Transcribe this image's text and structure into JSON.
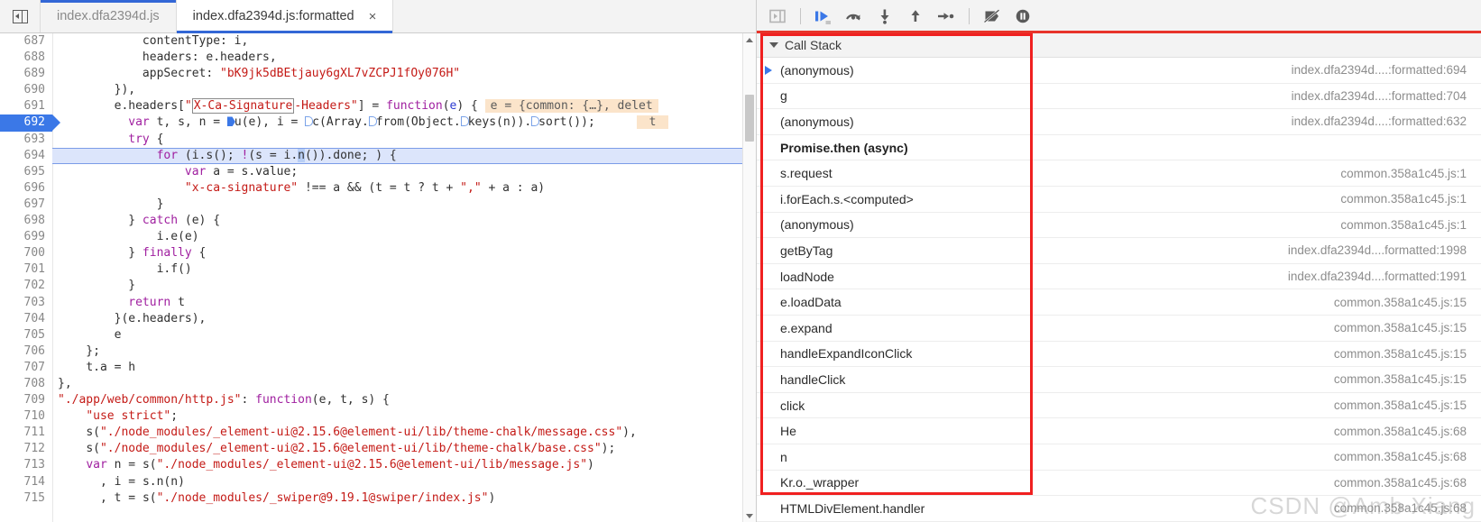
{
  "window": {
    "panel_toggle_label": "show-navigator",
    "tabs": [
      {
        "label": "index.dfa2394d.js",
        "active": false,
        "closable": false
      },
      {
        "label": "index.dfa2394d.js:formatted",
        "active": true,
        "closable": true,
        "close_label": "×"
      }
    ]
  },
  "debug_toolbar": {
    "buttons": [
      {
        "name": "resume-script-execution",
        "icon": "resume-icon",
        "active": true
      },
      {
        "name": "step-over-next-function-call",
        "icon": "step-over-icon",
        "active": false
      },
      {
        "name": "step-into-next-function-call",
        "icon": "step-into-icon",
        "active": false
      },
      {
        "name": "step-out-of-current-function",
        "icon": "step-out-icon",
        "active": false
      },
      {
        "name": "step",
        "icon": "step-icon",
        "active": false
      },
      {
        "name": "deactivate-breakpoints",
        "icon": "deactivate-breakpoints-icon",
        "active": false
      },
      {
        "name": "pause-on-exceptions",
        "icon": "pause-on-exceptions-icon",
        "active": false
      }
    ]
  },
  "editor": {
    "current_line": 692,
    "execution_line": 694,
    "first_line": 687,
    "inline_hint": "e = {common: {…}, delet",
    "lines": [
      {
        "n": "687",
        "indent": 12,
        "text": "contentType: i,"
      },
      {
        "n": "688",
        "indent": 12,
        "text": "headers: e.headers,"
      },
      {
        "n": "689",
        "indent": 12,
        "text": "appSecret: \"bK9jk5dBEtjauy6gXL7vZCPJ1fOy076H\""
      },
      {
        "n": "690",
        "indent": 8,
        "text": "}),"
      },
      {
        "n": "691",
        "indent": 8,
        "text": "e.headers[\"X-Ca-Signature-Headers\"] = function(e) {"
      },
      {
        "n": "692",
        "indent": 10,
        "text": "var t, s, n = u(e), i = c(Array.from(Object.keys(n)).sort());"
      },
      {
        "n": "693",
        "indent": 10,
        "text": "try {"
      },
      {
        "n": "694",
        "indent": 14,
        "text": "for (i.s(); !(s = i.n()).done; ) {"
      },
      {
        "n": "695",
        "indent": 18,
        "text": "var a = s.value;"
      },
      {
        "n": "696",
        "indent": 18,
        "text": "\"x-ca-signature\" !== a && (t = t ? t + \",\" + a : a)"
      },
      {
        "n": "697",
        "indent": 14,
        "text": "}"
      },
      {
        "n": "698",
        "indent": 10,
        "text": "} catch (e) {"
      },
      {
        "n": "699",
        "indent": 14,
        "text": "i.e(e)"
      },
      {
        "n": "700",
        "indent": 10,
        "text": "} finally {"
      },
      {
        "n": "701",
        "indent": 14,
        "text": "i.f()"
      },
      {
        "n": "702",
        "indent": 10,
        "text": "}"
      },
      {
        "n": "703",
        "indent": 10,
        "text": "return t"
      },
      {
        "n": "704",
        "indent": 8,
        "text": "}(e.headers),"
      },
      {
        "n": "705",
        "indent": 8,
        "text": "e"
      },
      {
        "n": "706",
        "indent": 4,
        "text": "};"
      },
      {
        "n": "707",
        "indent": 4,
        "text": "t.a = h"
      },
      {
        "n": "708",
        "indent": 0,
        "text": "},"
      },
      {
        "n": "709",
        "indent": 0,
        "text": "\"./app/web/common/http.js\": function(e, t, s) {"
      },
      {
        "n": "710",
        "indent": 4,
        "text": "\"use strict\";"
      },
      {
        "n": "711",
        "indent": 4,
        "text": "s(\"./node_modules/_element-ui@2.15.6@element-ui/lib/theme-chalk/message.css\"),"
      },
      {
        "n": "712",
        "indent": 4,
        "text": "s(\"./node_modules/_element-ui@2.15.6@element-ui/lib/theme-chalk/base.css\");"
      },
      {
        "n": "713",
        "indent": 4,
        "text": "var n = s(\"./node_modules/_element-ui@2.15.6@element-ui/lib/message.js\")"
      },
      {
        "n": "714",
        "indent": 6,
        "text": ", i = s.n(n)"
      },
      {
        "n": "715",
        "indent": 6,
        "text": ", t = s(\"./node_modules/_swiper@9.19.1@swiper/index.js\")"
      }
    ]
  },
  "call_stack": {
    "title": "Call Stack",
    "expanded": true,
    "frames": [
      {
        "name": "(anonymous)",
        "location": "index.dfa2394d....:formatted:694",
        "selected": true,
        "async": false
      },
      {
        "name": "g",
        "location": "index.dfa2394d....:formatted:704",
        "selected": false,
        "async": false
      },
      {
        "name": "(anonymous)",
        "location": "index.dfa2394d....:formatted:632",
        "selected": false,
        "async": false
      },
      {
        "name": "Promise.then (async)",
        "location": "",
        "selected": false,
        "async": true
      },
      {
        "name": "s.request",
        "location": "common.358a1c45.js:1",
        "selected": false,
        "async": false
      },
      {
        "name": "i.forEach.s.<computed>",
        "location": "common.358a1c45.js:1",
        "selected": false,
        "async": false
      },
      {
        "name": "(anonymous)",
        "location": "common.358a1c45.js:1",
        "selected": false,
        "async": false
      },
      {
        "name": "getByTag",
        "location": "index.dfa2394d....formatted:1998",
        "selected": false,
        "async": false
      },
      {
        "name": "loadNode",
        "location": "index.dfa2394d....formatted:1991",
        "selected": false,
        "async": false
      },
      {
        "name": "e.loadData",
        "location": "common.358a1c45.js:15",
        "selected": false,
        "async": false
      },
      {
        "name": "e.expand",
        "location": "common.358a1c45.js:15",
        "selected": false,
        "async": false
      },
      {
        "name": "handleExpandIconClick",
        "location": "common.358a1c45.js:15",
        "selected": false,
        "async": false
      },
      {
        "name": "handleClick",
        "location": "common.358a1c45.js:15",
        "selected": false,
        "async": false
      },
      {
        "name": "click",
        "location": "common.358a1c45.js:15",
        "selected": false,
        "async": false
      },
      {
        "name": "He",
        "location": "common.358a1c45.js:68",
        "selected": false,
        "async": false
      },
      {
        "name": "n",
        "location": "common.358a1c45.js:68",
        "selected": false,
        "async": false
      },
      {
        "name": "Kr.o._wrapper",
        "location": "common.358a1c45.js:68",
        "selected": false,
        "async": false
      },
      {
        "name": "HTMLDivElement.handler",
        "location": "common.358a1c45.js:68",
        "selected": false,
        "async": false
      }
    ]
  },
  "annotation": {
    "highlight_color": "#f02020"
  },
  "watermark": {
    "text": "CSDN @Amb Xiang"
  }
}
